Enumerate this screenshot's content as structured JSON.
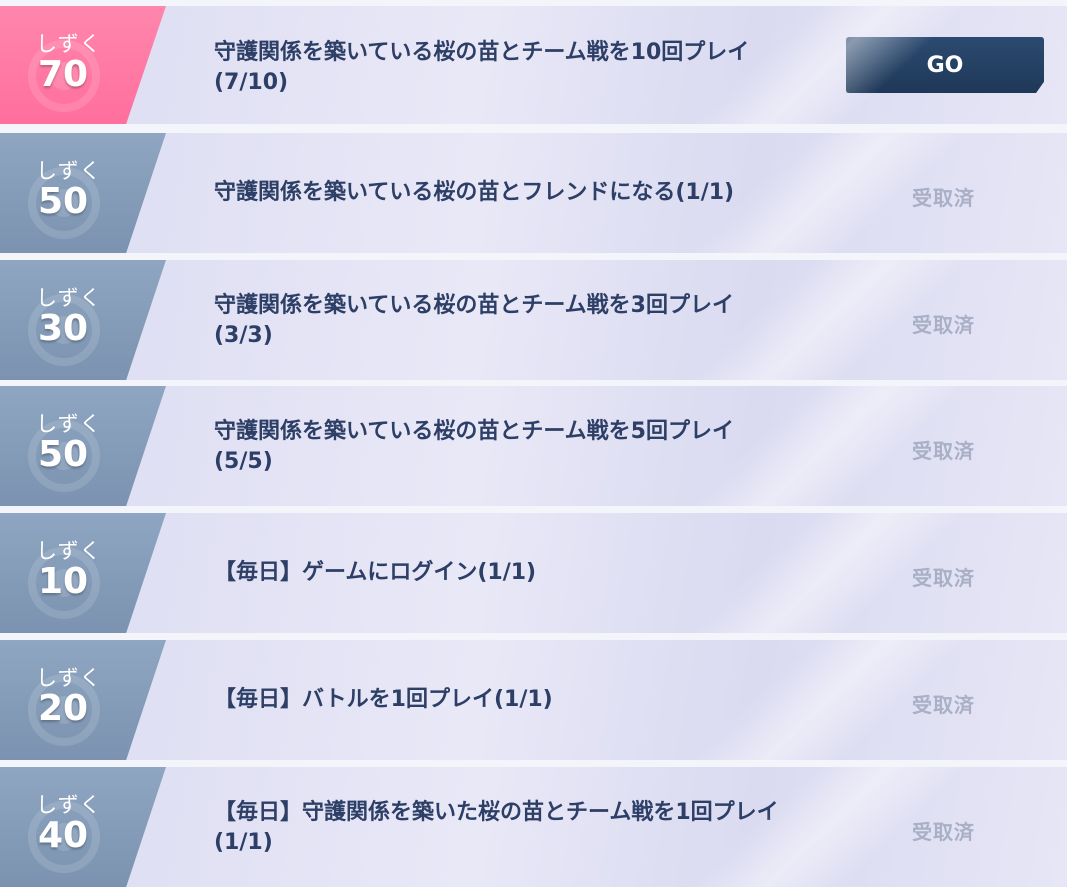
{
  "missions": [
    {
      "unit": "しずく",
      "amount": "70",
      "description": "守護関係を築いている桜の苗とチーム戦を10回プレイ\n(7/10)",
      "status": "",
      "button": "GO",
      "active": true
    },
    {
      "unit": "しずく",
      "amount": "50",
      "description": "守護関係を築いている桜の苗とフレンドになる(1/1)",
      "status": "受取済",
      "button": "",
      "active": false
    },
    {
      "unit": "しずく",
      "amount": "30",
      "description": "守護関係を築いている桜の苗とチーム戦を3回プレイ\n(3/3)",
      "status": "受取済",
      "button": "",
      "active": false
    },
    {
      "unit": "しずく",
      "amount": "50",
      "description": "守護関係を築いている桜の苗とチーム戦を5回プレイ\n(5/5)",
      "status": "受取済",
      "button": "",
      "active": false
    },
    {
      "unit": "しずく",
      "amount": "10",
      "description": "【毎日】ゲームにログイン(1/1)",
      "status": "受取済",
      "button": "",
      "active": false
    },
    {
      "unit": "しずく",
      "amount": "20",
      "description": "【毎日】バトルを1回プレイ(1/1)",
      "status": "受取済",
      "button": "",
      "active": false
    },
    {
      "unit": "しずく",
      "amount": "40",
      "description": "【毎日】守護関係を築いた桜の苗とチーム戦を1回プレイ\n(1/1)",
      "status": "受取済",
      "button": "",
      "active": false
    }
  ],
  "colors": {
    "badge_active": "#ff7aa5",
    "badge_inactive": "#859cb8",
    "text_primary": "#2d3f66",
    "status_claimed": "#a9b0c6",
    "go_button": "#24406a"
  }
}
